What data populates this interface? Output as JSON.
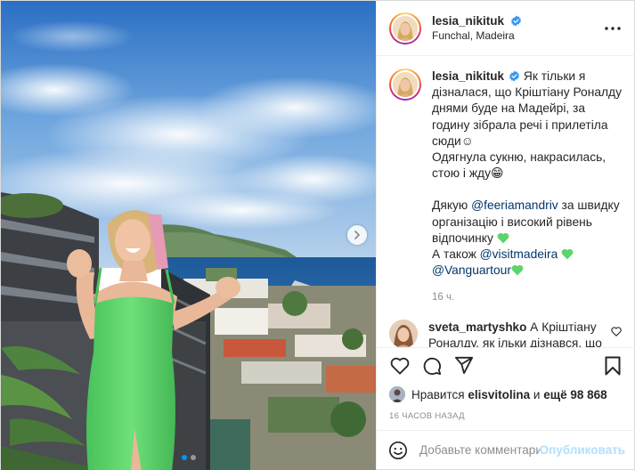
{
  "colors": {
    "link": "#00376b",
    "accent": "#0095f6",
    "verified": "#3897f0",
    "publish_disabled": "#b2dffc",
    "muted": "#8e8e8e",
    "dress_green": "#5ed36c"
  },
  "media": {
    "carousel_total": 2,
    "carousel_active": 1,
    "next_icon": "chevron-right-icon"
  },
  "header": {
    "username": "lesia_nikituk",
    "verified_icon": "verified-badge-icon",
    "location": "Funchal, Madeira",
    "more_icon": "more-horizontal-icon"
  },
  "caption": {
    "username": "lesia_nikituk",
    "parts": [
      "Як тільки я дізналася, що Кріштіану Роналду днями буде на Мадейрі, за годину зібрала речі і прилетіла сюди",
      "☺",
      "Одягнула сукню, накрасилась, стою і жду",
      "😁",
      "Дякую",
      "@feeriamandriv",
      "за швидку організацію і високий рівень відпочинку",
      "А також",
      "@visitmadeira",
      "@Vanguartour"
    ],
    "heart_icon": "green-heart-icon",
    "time": "16 ч."
  },
  "comments": [
    {
      "username": "sveta_martyshko",
      "text": "А Кріштіану Роналду, як ільки дізнався, що там буде Леся, полетів в Мексику",
      "emoji": "😁",
      "like_icon": "heart-outline-icon"
    }
  ],
  "actions": {
    "like_icon": "heart-outline-icon",
    "comment_icon": "comment-icon",
    "share_icon": "paper-plane-icon",
    "save_icon": "bookmark-icon"
  },
  "likes": {
    "prefix": "Нравится",
    "user": "elisvitolina",
    "conjunction": "и",
    "more": "ещё 98 868"
  },
  "timestamp": "16 ЧАСОВ НАЗАД",
  "add_comment": {
    "emoji_icon": "smiley-icon",
    "placeholder": "Добавьте комментарий...",
    "publish_label": "Опубликовать"
  }
}
